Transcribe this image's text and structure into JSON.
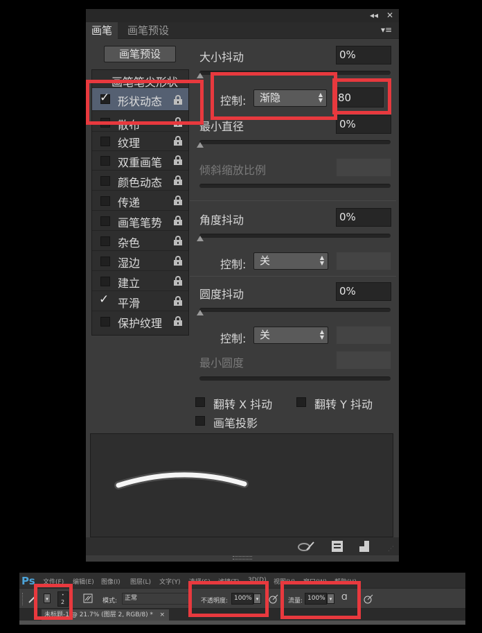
{
  "panel": {
    "tabs": [
      "画笔",
      "画笔预设"
    ],
    "preset_button": "画笔预设",
    "list_items": [
      {
        "label": "画笔笔尖形状",
        "checked": false
      },
      {
        "label": "形状动态",
        "checked": true,
        "selected": true
      },
      {
        "label": "散布",
        "checked": false
      },
      {
        "label": "纹理",
        "checked": false
      },
      {
        "label": "双重画笔",
        "checked": false
      },
      {
        "label": "颜色动态",
        "checked": false
      },
      {
        "label": "传递",
        "checked": false
      },
      {
        "label": "画笔笔势",
        "checked": false
      },
      {
        "label": "杂色",
        "checked": false
      },
      {
        "label": "湿边",
        "checked": false
      },
      {
        "label": "建立",
        "checked": false
      },
      {
        "label": "平滑",
        "checked": true
      },
      {
        "label": "保护纹理",
        "checked": false
      }
    ],
    "size_jitter": {
      "label": "大小抖动",
      "value": "0%"
    },
    "size_control": {
      "label": "控制:",
      "value": "渐隐",
      "steps": "80"
    },
    "min_diameter": {
      "label": "最小直径",
      "value": "0%"
    },
    "tilt_scale": {
      "label": "倾斜缩放比例"
    },
    "angle_jitter": {
      "label": "角度抖动",
      "value": "0%"
    },
    "angle_control": {
      "label": "控制:",
      "value": "关"
    },
    "roundness_jitter": {
      "label": "圆度抖动",
      "value": "0%"
    },
    "roundness_control": {
      "label": "控制:",
      "value": "关"
    },
    "min_roundness": {
      "label": "最小圆度"
    },
    "flip_x": "翻转 X 抖动",
    "flip_y": "翻转 Y 抖动",
    "brush_projection": "画笔投影"
  },
  "ps": {
    "logo": "Ps",
    "menu": [
      "文件(F)",
      "编辑(E)",
      "图像(I)",
      "图层(L)",
      "文字(Y)",
      "选择(S)",
      "滤镜(T)",
      "3D(D)",
      "视图(V)",
      "窗口(W)",
      "帮助(H)"
    ],
    "brush_size": "2",
    "mode_label": "模式:",
    "mode_value": "正常",
    "opacity_label": "不透明度:",
    "opacity_value": "100%",
    "flow_label": "流量:",
    "flow_value": "100%",
    "doc_tab": "未标题-1 @ 21.7% (图层 2, RGB/8) *",
    "doc_close": "×"
  },
  "colors": {
    "highlight": "#e8393e",
    "selected_row": "#556072",
    "ps_logo": "#4ca3d8"
  },
  "icons": [
    "collapse-icon",
    "close-icon",
    "panel-menu-icon",
    "lock-icon",
    "checkmark-icon",
    "brush-stroke-icon",
    "new-preset-icon",
    "new-brush-icon",
    "gripper-icon"
  ]
}
